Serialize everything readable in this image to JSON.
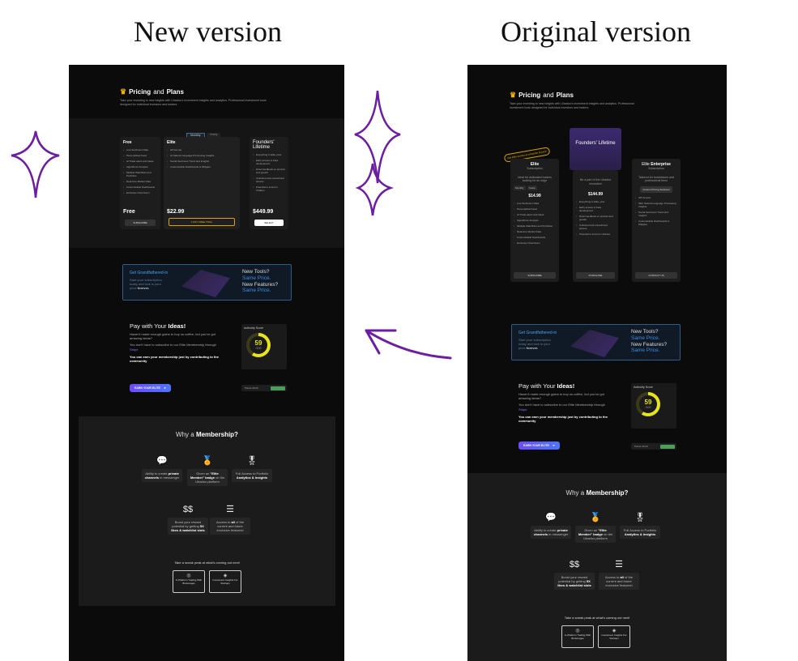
{
  "labels": {
    "new_version": "New version",
    "original_version": "Original version"
  },
  "header": {
    "title_bold": "Pricing",
    "title_plain": "and",
    "title_bold2": "Plans",
    "subtitle": "Take your investing to new heights with Ulradoo's investment insights and analytics. Professional investment tools designed for individual investors and traders."
  },
  "new_plans": {
    "toggle": [
      "Monthly",
      "Yearly"
    ],
    "free": {
      "name": "Free",
      "price": "Free",
      "cta": "SUBSCRIBE",
      "features": [
        "Live Sentiment Data",
        "Personalized Feed",
        "AI Trade alerts and Ideas",
        "Algorithmic Analysis",
        "Multiple Watchlists and Portfolios",
        "Real-time Market Data",
        "Customizable Dashboards",
        "Exclusive Chat Room"
      ]
    },
    "elite": {
      "name": "Elite",
      "price": "22.99",
      "cta": "7-DAY FREE TRIAL",
      "features": [
        "All free tier",
        "AI Natural Language Processing Insights",
        "Social Sentiment Trend and Insights",
        "Customizable Dashboards & Widgets"
      ]
    },
    "founders": {
      "name": "Founders' Lifetime",
      "price": "449.99",
      "cta": "SELECT",
      "features": [
        "Everything in Elite, plus",
        "Early access to beta development",
        "Direct feedback on product and growth",
        "Unlimited and unrestricted access",
        "Potential to invest in Ulradoo"
      ]
    }
  },
  "orig_plans": {
    "badge": "Get Elite access at a fraction of price",
    "elite": {
      "name": "Elite",
      "sub": "Subscription",
      "desc": "Ideal for dedicated traders looking for an edge",
      "price": "14.99",
      "cta": "SUBSCRIBE",
      "tabs": [
        "Monthly",
        "Yearly"
      ],
      "features": [
        "Live Sentiment Data",
        "Personalized Feed",
        "AI Trade alerts and Ideas",
        "Algorithmic Analysis",
        "Multiple Watchlists and Portfolios",
        "Real-time Market Data",
        "Customizable Dashboards",
        "Exclusive Chat Room"
      ]
    },
    "founders": {
      "name": "Founders' Lifetime",
      "desc": "Be a part of the Ulradoo revolution",
      "price": "144.99",
      "cta": "PURCHASE",
      "features": [
        "Everything in Elite, plus",
        "Early access to beta development",
        "Direct feedback on product and growth",
        "Unlimited and unrestricted access",
        "Potential to invest in Ulradoo"
      ]
    },
    "enterprise": {
      "name_plain": "Elite",
      "name_bold": "Enterprise",
      "sub": "Subscription",
      "desc": "Tailored for businesses and professional firms",
      "cta_top": "Custom Pricing Solutions",
      "cta": "CONTACT US",
      "features": [
        "API Access",
        "SEC Natural Language Processing Insights",
        "Social Sentiment Trend and Insights",
        "Customizable Dashboards & Widgets"
      ]
    }
  },
  "grandfather": {
    "title": "Get Grandfathered-in",
    "desc1": "Start your subscription",
    "desc2": "today and lock in your",
    "desc3_plain": "price",
    "desc3_bold": "forever.",
    "line1": "New Tools?",
    "line2": "Same Price.",
    "line3": "New Features?",
    "line4": "Same Price."
  },
  "pay": {
    "title_plain": "Pay with Your",
    "title_bold": "Ideas!",
    "desc1": "Haven't made enough gains to buy us coffee, but you've got amazing ideas?",
    "desc2": "You don't have to subscribe to our Elite Membership through",
    "desc2_link": "Stripe",
    "bold": "You can earn your membership just by contributing to the community",
    "cta": "EARN YOUR ELITE",
    "authority_label": "Authority Score",
    "score": "59",
    "score_unit": "/100",
    "score_fraction": 0.59,
    "points_label": "Points",
    "points": "20.23"
  },
  "why": {
    "title_plain": "Why a",
    "title_bold": "Membership?",
    "benefits": [
      {
        "icon": "chat-icon",
        "text1": "Ability to create",
        "bold": "private channels",
        "text2": "in messenger"
      },
      {
        "icon": "badge-icon",
        "text1": "Given an",
        "bold": "\"Elite Member\" badge",
        "text2": "on the Ulradoo platform"
      },
      {
        "icon": "medal-icon",
        "text1": "Full Access to Portfolio",
        "bold": "Analytics & Insights",
        "text2": ""
      },
      {
        "icon": "dollar-icon",
        "text1": "Boost your reward potential by getting",
        "bold": "5X likes & watchlist slots",
        "text2": ""
      },
      {
        "icon": "list-icon",
        "text1": "Access to",
        "bold": "all",
        "text2": "of the current and future exclusive features!"
      }
    ],
    "peek": "Take a sneak peak at what's coming out next!",
    "upcoming": [
      "In-Platform Trading With Brokerages",
      "Investment Insights For Startups"
    ]
  }
}
